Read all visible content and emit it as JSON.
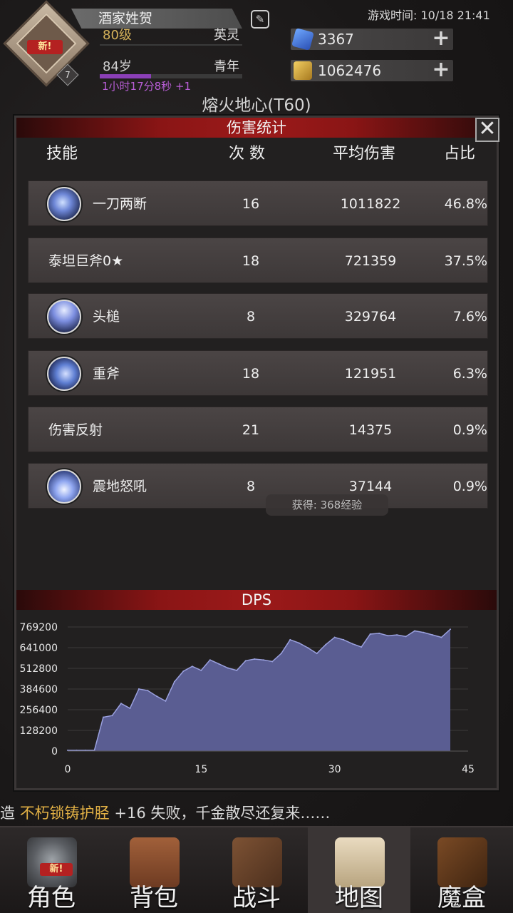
{
  "player": {
    "name": "酒家姓贺",
    "level_text": "80级",
    "rank": "英灵",
    "age_text": "84岁",
    "age_stage": "青年",
    "timer_text": "1小时17分8秒 +1",
    "avatar_badge": "新!",
    "avatar_level": "7"
  },
  "game_time": "游戏时间: 10/18 21:41",
  "currencies": [
    {
      "icon": "gem-icon",
      "value": "3367",
      "color": "#4f7ee6"
    },
    {
      "icon": "gold-icon",
      "value": "1062476",
      "color": "#d6a938"
    }
  ],
  "zone": {
    "title": "熔火地心(T60)"
  },
  "modal": {
    "title": "伤害统计",
    "close_glyph": "✕",
    "columns": {
      "skill": "技能",
      "count": "次 数",
      "avg": "平均伤害",
      "pct": "占比"
    },
    "rows": [
      {
        "name": "一刀两断",
        "count": "16",
        "avg": "1011822",
        "pct": "46.8%",
        "icon": "slash-skill-icon"
      },
      {
        "name": "泰坦巨斧0★",
        "count": "18",
        "avg": "721359",
        "pct": "37.5%",
        "icon": ""
      },
      {
        "name": "头槌",
        "count": "8",
        "avg": "329764",
        "pct": "7.6%",
        "icon": "headbutt-skill-icon"
      },
      {
        "name": "重斧",
        "count": "18",
        "avg": "121951",
        "pct": "6.3%",
        "icon": "heavy-axe-skill-icon"
      },
      {
        "name": "伤害反射",
        "count": "21",
        "avg": "14375",
        "pct": "0.9%",
        "icon": ""
      },
      {
        "name": "震地怒吼",
        "count": "8",
        "avg": "37144",
        "pct": "0.9%",
        "icon": "roar-skill-icon"
      }
    ],
    "exp_tooltip": "获得: 368经验",
    "dps_title": "DPS"
  },
  "chart_data": {
    "type": "area",
    "title": "DPS",
    "x_ticks": [
      0,
      15,
      30,
      45
    ],
    "y_ticks": [
      0,
      128200,
      256400,
      384600,
      512800,
      641000,
      769200
    ],
    "xlim": [
      0,
      45
    ],
    "ylim": [
      0,
      769200
    ],
    "fill_color": "#5a5d92",
    "line_color": "#9aa0de",
    "x": [
      0,
      1,
      2,
      3,
      4,
      5,
      6,
      7,
      8,
      9,
      10,
      11,
      12,
      13,
      14,
      15,
      16,
      17,
      18,
      19,
      20,
      21,
      22,
      23,
      24,
      25,
      26,
      27,
      28,
      29,
      30,
      31,
      32,
      33,
      34,
      35,
      36,
      37,
      38,
      39,
      40,
      41,
      42,
      43
    ],
    "y": [
      5000,
      5000,
      5000,
      5000,
      210000,
      220000,
      295000,
      265000,
      385000,
      375000,
      340000,
      310000,
      430000,
      495000,
      525000,
      500000,
      565000,
      540000,
      515000,
      500000,
      560000,
      570000,
      565000,
      555000,
      605000,
      690000,
      670000,
      640000,
      605000,
      660000,
      705000,
      690000,
      665000,
      645000,
      725000,
      730000,
      715000,
      720000,
      710000,
      745000,
      735000,
      720000,
      705000,
      755000,
      770000
    ]
  },
  "combat_log": {
    "prefix": "造 ",
    "item": "不朽锁铸护胫",
    "suffix": " +16 失败，千金散尽还复来……"
  },
  "nav": [
    {
      "label": "角色",
      "icon": "helmet-icon",
      "badge": "新!"
    },
    {
      "label": "背包",
      "icon": "backpack-icon",
      "badge": ""
    },
    {
      "label": "战斗",
      "icon": "sword-shield-icon",
      "badge": ""
    },
    {
      "label": "地图",
      "icon": "map-scroll-icon",
      "badge": ""
    },
    {
      "label": "魔盒",
      "icon": "magic-box-icon",
      "badge": ""
    }
  ]
}
